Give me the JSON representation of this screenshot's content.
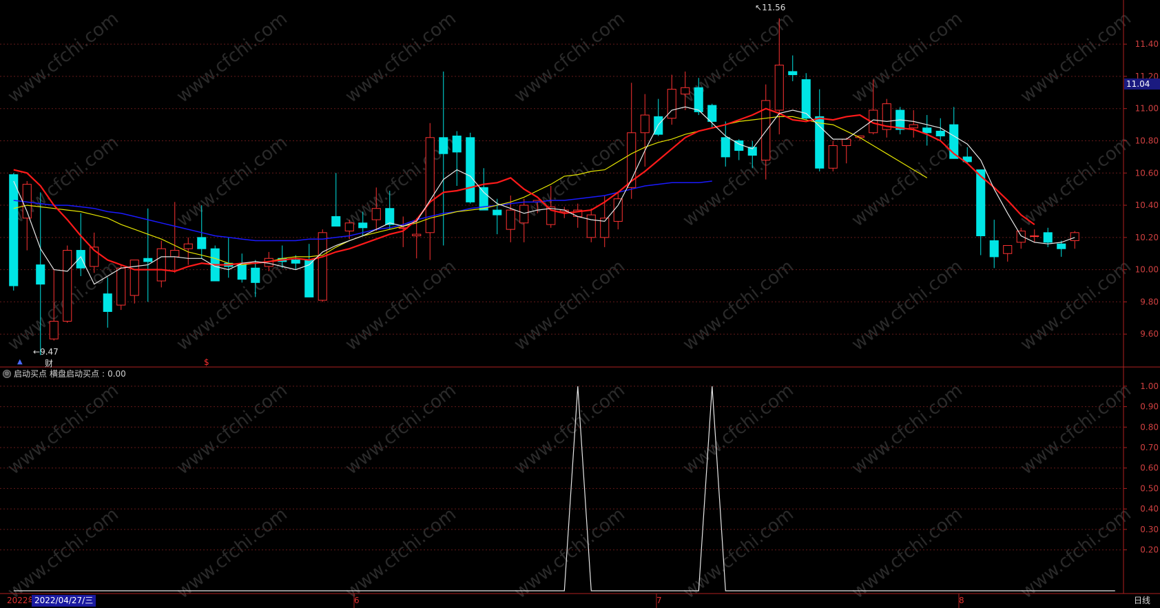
{
  "chart_data": [
    {
      "type": "candlestick",
      "title": "",
      "ylim": [
        9.4,
        11.58
      ],
      "y_ticks": [
        "11.40",
        "11.20",
        "11.00",
        "10.80",
        "10.60",
        "10.40",
        "10.20",
        "10.00",
        "9.80",
        "9.60"
      ],
      "last_price": "11.04",
      "high_label": "11.56",
      "low_label": "9.47",
      "low_arrow": "←",
      "high_arrow": "↖",
      "marks": [
        "▲",
        "财",
        "$"
      ],
      "candles": [
        [
          10.59,
          10.6,
          9.87,
          9.9
        ],
        [
          10.32,
          10.55,
          10.12,
          10.53
        ],
        [
          10.03,
          10.48,
          9.47,
          9.91
        ],
        [
          9.57,
          10.0,
          9.56,
          9.68
        ],
        [
          9.68,
          10.15,
          9.67,
          10.12
        ],
        [
          10.12,
          10.35,
          9.96,
          10.01
        ],
        [
          10.02,
          10.23,
          9.98,
          10.14
        ],
        [
          9.85,
          9.95,
          9.64,
          9.74
        ],
        [
          9.78,
          10.03,
          9.75,
          10.01
        ],
        [
          9.84,
          10.06,
          9.79,
          10.06
        ],
        [
          10.07,
          10.38,
          9.8,
          10.05
        ],
        [
          9.93,
          10.18,
          9.89,
          10.13
        ],
        [
          10.08,
          10.42,
          9.98,
          10.12
        ],
        [
          10.13,
          10.2,
          10.03,
          10.16
        ],
        [
          10.2,
          10.4,
          10.07,
          10.13
        ],
        [
          10.13,
          10.15,
          9.95,
          9.93
        ],
        [
          10.04,
          10.2,
          9.95,
          10.02
        ],
        [
          10.03,
          10.1,
          9.92,
          9.94
        ],
        [
          10.01,
          10.06,
          9.83,
          9.92
        ],
        [
          10.02,
          10.11,
          9.99,
          10.07
        ],
        [
          10.07,
          10.15,
          10.01,
          10.05
        ],
        [
          10.06,
          10.09,
          10.0,
          10.04
        ],
        [
          10.06,
          10.16,
          9.84,
          9.83
        ],
        [
          9.81,
          10.25,
          9.8,
          10.23
        ],
        [
          10.33,
          10.6,
          10.3,
          10.27
        ],
        [
          10.24,
          10.31,
          10.19,
          10.29
        ],
        [
          10.29,
          10.36,
          10.21,
          10.26
        ],
        [
          10.31,
          10.51,
          10.24,
          10.38
        ],
        [
          10.38,
          10.49,
          10.25,
          10.28
        ],
        [
          10.26,
          10.33,
          10.14,
          10.26
        ],
        [
          10.21,
          10.32,
          10.07,
          10.22
        ],
        [
          10.23,
          10.91,
          10.06,
          10.82
        ],
        [
          10.82,
          11.23,
          10.15,
          10.72
        ],
        [
          10.83,
          10.86,
          10.52,
          10.73
        ],
        [
          10.82,
          10.85,
          10.41,
          10.42
        ],
        [
          10.51,
          10.63,
          10.38,
          10.37
        ],
        [
          10.37,
          10.44,
          10.22,
          10.34
        ],
        [
          10.25,
          10.46,
          10.17,
          10.37
        ],
        [
          10.29,
          10.44,
          10.17,
          10.4
        ],
        [
          10.42,
          10.42,
          10.35,
          10.43
        ],
        [
          10.28,
          10.52,
          10.26,
          10.39
        ],
        [
          10.36,
          10.39,
          10.32,
          10.37
        ],
        [
          10.33,
          10.41,
          10.26,
          10.37
        ],
        [
          10.2,
          10.38,
          10.17,
          10.34
        ],
        [
          10.2,
          10.46,
          10.14,
          10.32
        ],
        [
          10.3,
          10.48,
          10.25,
          10.44
        ],
        [
          10.51,
          11.16,
          10.44,
          10.85
        ],
        [
          10.85,
          11.09,
          10.64,
          10.96
        ],
        [
          10.95,
          11.06,
          10.83,
          10.84
        ],
        [
          10.94,
          11.21,
          10.9,
          11.12
        ],
        [
          11.09,
          11.23,
          10.99,
          11.13
        ],
        [
          11.13,
          11.19,
          10.96,
          10.98
        ],
        [
          11.02,
          11.03,
          10.88,
          10.92
        ],
        [
          10.82,
          10.92,
          10.64,
          10.7
        ],
        [
          10.8,
          10.81,
          10.68,
          10.74
        ],
        [
          10.76,
          10.8,
          10.63,
          10.71
        ],
        [
          10.68,
          11.15,
          10.56,
          11.05
        ],
        [
          10.99,
          11.56,
          10.84,
          11.27
        ],
        [
          11.23,
          11.33,
          11.17,
          11.21
        ],
        [
          11.18,
          11.22,
          10.93,
          10.94
        ],
        [
          10.95,
          11.12,
          10.61,
          10.63
        ],
        [
          10.63,
          10.8,
          10.61,
          10.77
        ],
        [
          10.77,
          10.82,
          10.66,
          10.81
        ],
        [
          10.82,
          10.82,
          10.8,
          10.83
        ],
        [
          10.85,
          11.18,
          10.84,
          10.99
        ],
        [
          10.87,
          11.06,
          10.82,
          11.03
        ],
        [
          10.99,
          11.01,
          10.84,
          10.87
        ],
        [
          10.88,
          10.99,
          10.82,
          10.9
        ],
        [
          10.88,
          10.96,
          10.77,
          10.85
        ],
        [
          10.86,
          10.94,
          10.8,
          10.83
        ],
        [
          10.9,
          11.01,
          10.77,
          10.69
        ],
        [
          10.7,
          10.76,
          10.66,
          10.67
        ],
        [
          10.62,
          10.62,
          10.09,
          10.21
        ],
        [
          10.18,
          10.31,
          10.01,
          10.08
        ],
        [
          10.1,
          10.13,
          10.05,
          10.15
        ],
        [
          10.17,
          10.26,
          10.13,
          10.24
        ],
        [
          10.21,
          10.25,
          10.17,
          10.21
        ],
        [
          10.23,
          10.26,
          10.14,
          10.17
        ],
        [
          10.16,
          10.18,
          10.08,
          10.13
        ],
        [
          10.18,
          10.24,
          10.13,
          10.23
        ]
      ],
      "ma_white": [
        10.55,
        10.36,
        10.13,
        10.0,
        9.99,
        10.08,
        9.91,
        9.96,
        10.01,
        10.02,
        10.03,
        10.08,
        10.08,
        10.07,
        10.07,
        10.02,
        10.0,
        10.04,
        10.05,
        10.04,
        10.02,
        10.0,
        10.03,
        10.11,
        10.15,
        10.18,
        10.21,
        10.25,
        10.29,
        10.27,
        10.3,
        10.43,
        10.56,
        10.62,
        10.58,
        10.48,
        10.41,
        10.38,
        10.35,
        10.37,
        10.38,
        10.37,
        10.33,
        10.31,
        10.3,
        10.4,
        10.56,
        10.74,
        10.9,
        10.99,
        11.01,
        10.99,
        10.91,
        10.83,
        10.78,
        10.75,
        10.86,
        10.97,
        10.99,
        10.97,
        10.89,
        10.81,
        10.81,
        10.87,
        10.93,
        10.92,
        10.93,
        10.92,
        10.9,
        10.88,
        10.83,
        10.78,
        10.68,
        10.5,
        10.35,
        10.21,
        10.17,
        10.16,
        10.17,
        10.2
      ],
      "ma_red": [
        10.62,
        10.6,
        10.52,
        10.4,
        10.31,
        10.21,
        10.12,
        10.06,
        10.03,
        10.0,
        10.0,
        10.0,
        9.99,
        10.02,
        10.04,
        10.03,
        10.03,
        10.04,
        10.04,
        10.05,
        10.06,
        10.07,
        10.06,
        10.08,
        10.11,
        10.13,
        10.16,
        10.19,
        10.22,
        10.24,
        10.31,
        10.42,
        10.48,
        10.49,
        10.51,
        10.53,
        10.54,
        10.57,
        10.5,
        10.45,
        10.37,
        10.35,
        10.36,
        10.37,
        10.42,
        10.48,
        10.55,
        10.61,
        10.68,
        10.75,
        10.82,
        10.86,
        10.88,
        10.9,
        10.93,
        10.96,
        11.0,
        10.97,
        10.93,
        10.92,
        10.94,
        10.93,
        10.95,
        10.96,
        10.91,
        10.89,
        10.88,
        10.87,
        10.84,
        10.8,
        10.72,
        10.66,
        10.58,
        10.51,
        10.43,
        10.34,
        10.28
      ],
      "ma_yellow": [
        10.38,
        10.4,
        10.39,
        10.38,
        10.37,
        10.36,
        10.34,
        10.32,
        10.28,
        10.25,
        10.22,
        10.19,
        10.15,
        10.11,
        10.09,
        10.07,
        10.04,
        10.03,
        10.04,
        10.05,
        10.07,
        10.08,
        10.08,
        10.09,
        10.14,
        10.18,
        10.21,
        10.23,
        10.25,
        10.27,
        10.29,
        10.32,
        10.34,
        10.36,
        10.37,
        10.38,
        10.4,
        10.42,
        10.45,
        10.49,
        10.53,
        10.58,
        10.59,
        10.61,
        10.62,
        10.67,
        10.72,
        10.76,
        10.79,
        10.81,
        10.84,
        10.86,
        10.88,
        10.9,
        10.92,
        10.93,
        10.94,
        10.95,
        10.95,
        10.93,
        10.91,
        10.9,
        10.86,
        10.82,
        10.77,
        10.72,
        10.67,
        10.62,
        10.57
      ],
      "ma_blue": [
        10.43,
        10.42,
        10.41,
        10.4,
        10.4,
        10.39,
        10.38,
        10.36,
        10.35,
        10.33,
        10.31,
        10.29,
        10.27,
        10.25,
        10.23,
        10.21,
        10.2,
        10.19,
        10.18,
        10.18,
        10.18,
        10.18,
        10.19,
        10.19,
        10.2,
        10.21,
        10.23,
        10.25,
        10.26,
        10.28,
        10.31,
        10.33,
        10.35,
        10.36,
        10.38,
        10.39,
        10.4,
        10.41,
        10.42,
        10.42,
        10.43,
        10.43,
        10.44,
        10.45,
        10.46,
        10.48,
        10.5,
        10.52,
        10.53,
        10.54,
        10.54,
        10.54,
        10.55
      ]
    },
    {
      "type": "line",
      "title": "启动买点",
      "series": [
        {
          "name": "横盘启动买点",
          "last_value": "0.00",
          "values": [
            0,
            0,
            0,
            0,
            0,
            0,
            0,
            0,
            0,
            0,
            0,
            0,
            0,
            0,
            0,
            0,
            0,
            0,
            0,
            0,
            0,
            0,
            0,
            0,
            0,
            0,
            0,
            0,
            0,
            0,
            0,
            0,
            0,
            0,
            0,
            0,
            0,
            0,
            0,
            0,
            0,
            0,
            1,
            0,
            0,
            0,
            0,
            0,
            0,
            0,
            0,
            0,
            1,
            0,
            0,
            0,
            0,
            0,
            0,
            0,
            0,
            0,
            0,
            0,
            0,
            0,
            0,
            0,
            0,
            0,
            0,
            0,
            0,
            0,
            0,
            0,
            0,
            0,
            0,
            0,
            0,
            0,
            0
          ]
        }
      ],
      "ylim": [
        0,
        1.05
      ],
      "y_ticks": [
        "1.00",
        "0.90",
        "0.80",
        "0.70",
        "0.60",
        "0.50",
        "0.40",
        "0.30",
        "0.20"
      ]
    }
  ],
  "x_axis": {
    "year": "2022年",
    "selected_date": "2022/04/27/三",
    "months": [
      "6",
      "7",
      "8"
    ],
    "period": "日线"
  },
  "watermark": "www.cfchi.com",
  "colors": {
    "up": "#ff3232",
    "down": "#00e5e5",
    "ma_white": "#e8e8e8",
    "ma_red": "#ff1a1a",
    "ma_yellow": "#e6e600",
    "ma_blue": "#1a1aff",
    "grid": "#661a1a"
  }
}
